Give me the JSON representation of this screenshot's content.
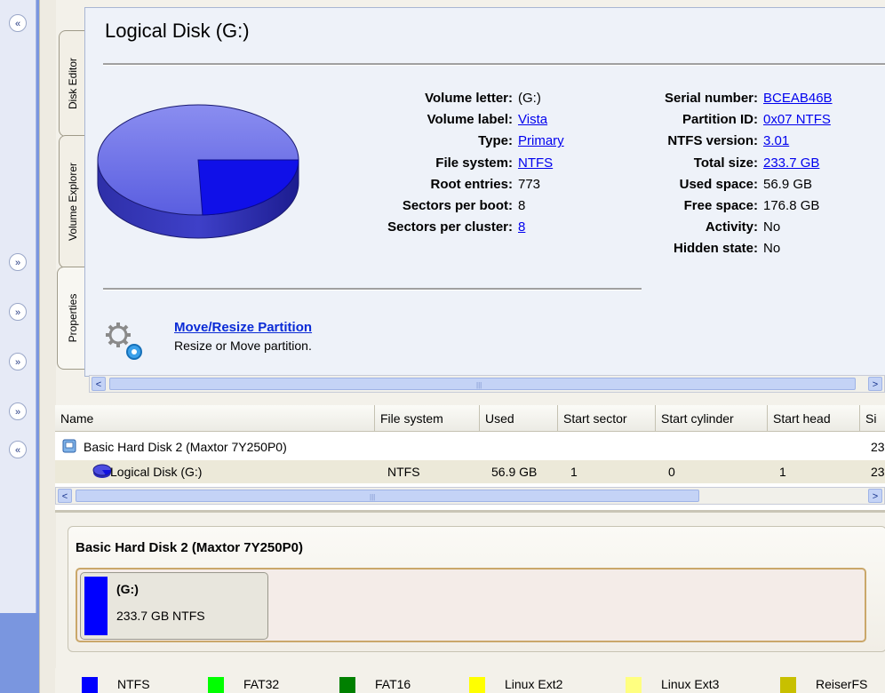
{
  "sidebar": {
    "collapse_up": "«",
    "collapse_down": "»"
  },
  "tabs": [
    "Disk Editor",
    "Volume Explorer",
    "Properties"
  ],
  "title": "Logical Disk (G:)",
  "properties_left": [
    {
      "label": "Volume letter:",
      "value": "(G:)",
      "link": false
    },
    {
      "label": "Volume label:",
      "value": "Vista",
      "link": true
    },
    {
      "label": "Type:",
      "value": "Primary",
      "link": true
    },
    {
      "label": "File system:",
      "value": "NTFS",
      "link": true
    },
    {
      "label": "Root entries:",
      "value": "773",
      "link": false
    },
    {
      "label": "Sectors per boot:",
      "value": "8",
      "link": false
    },
    {
      "label": "Sectors per cluster:",
      "value": "8",
      "link": true
    }
  ],
  "properties_right": [
    {
      "label": "Serial number:",
      "value": "BCEAB46B",
      "link": true
    },
    {
      "label": "Partition ID:",
      "value": "0x07 NTFS",
      "link": true
    },
    {
      "label": "NTFS version:",
      "value": "3.01",
      "link": true
    },
    {
      "label": "Total size:",
      "value": "233.7 GB",
      "link": true
    },
    {
      "label": "Used space:",
      "value": "56.9 GB",
      "link": false
    },
    {
      "label": "Free space:",
      "value": "176.8 GB",
      "link": false
    },
    {
      "label": "Activity:",
      "value": "No",
      "link": false
    },
    {
      "label": "Hidden state:",
      "value": "No",
      "link": false
    }
  ],
  "usage": {
    "used_fraction": 0.243
  },
  "action": {
    "title": "Move/Resize Partition",
    "description": "Resize or Move partition."
  },
  "table": {
    "columns": [
      "Name",
      "File system",
      "Used",
      "Start sector",
      "Start cylinder",
      "Start head",
      "Si"
    ],
    "rows": [
      {
        "name": "Basic Hard Disk 2 (Maxtor 7Y250P0)",
        "fs": "",
        "used": "",
        "start_sector": "",
        "start_cylinder": "",
        "start_head": "",
        "size": "23"
      },
      {
        "name": "Logical Disk (G:)",
        "fs": "NTFS",
        "used": "56.9 GB",
        "start_sector": "1",
        "start_cylinder": "0",
        "start_head": "1",
        "size": "23"
      }
    ]
  },
  "diskmap": {
    "title": "Basic Hard Disk 2 (Maxtor 7Y250P0)",
    "partition": {
      "letter": "(G:)",
      "info": "233.7 GB NTFS",
      "color": "#0000ff"
    }
  },
  "legend": [
    {
      "label": "NTFS",
      "color": "#0000ff"
    },
    {
      "label": "FAT32",
      "color": "#00ff00"
    },
    {
      "label": "FAT16",
      "color": "#008000"
    },
    {
      "label": "Linux Ext2",
      "color": "#ffff00"
    },
    {
      "label": "Linux Ext3",
      "color": "#ffff80"
    },
    {
      "label": "ReiserFS",
      "color": "#c8c000"
    }
  ]
}
